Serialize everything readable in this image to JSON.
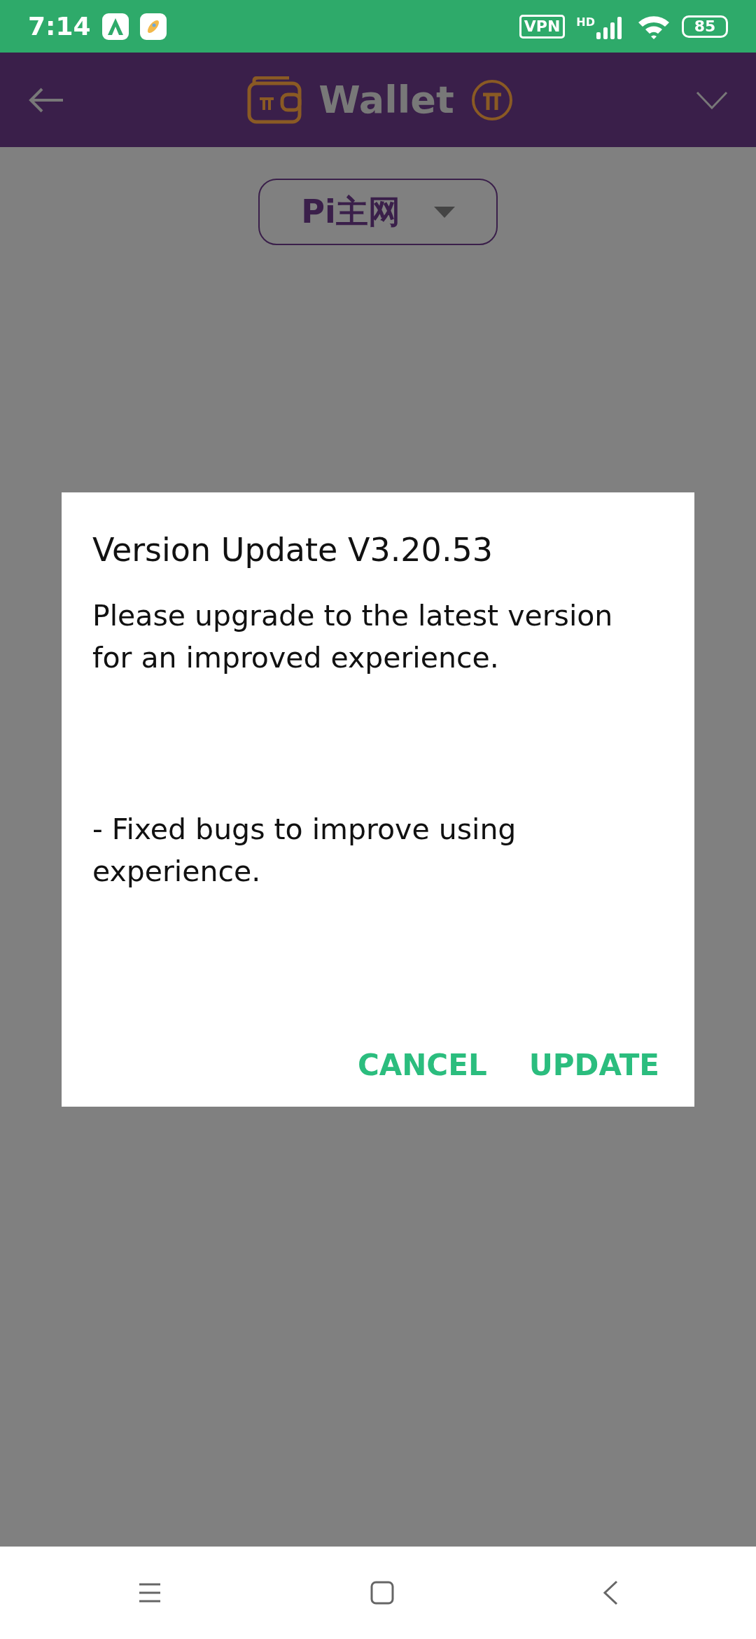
{
  "status_bar": {
    "time": "7:14",
    "vpn": "VPN",
    "network": "HD",
    "battery": "85"
  },
  "header": {
    "title": "Wallet"
  },
  "network_selector": {
    "value": "Pi主网"
  },
  "dialog": {
    "title": "Version Update V3.20.53",
    "message": "Please upgrade to the latest version for an improved experience.",
    "notes": "- Fixed bugs to improve using experience.",
    "buttons": [
      "CANCEL",
      "UPDATE"
    ]
  }
}
